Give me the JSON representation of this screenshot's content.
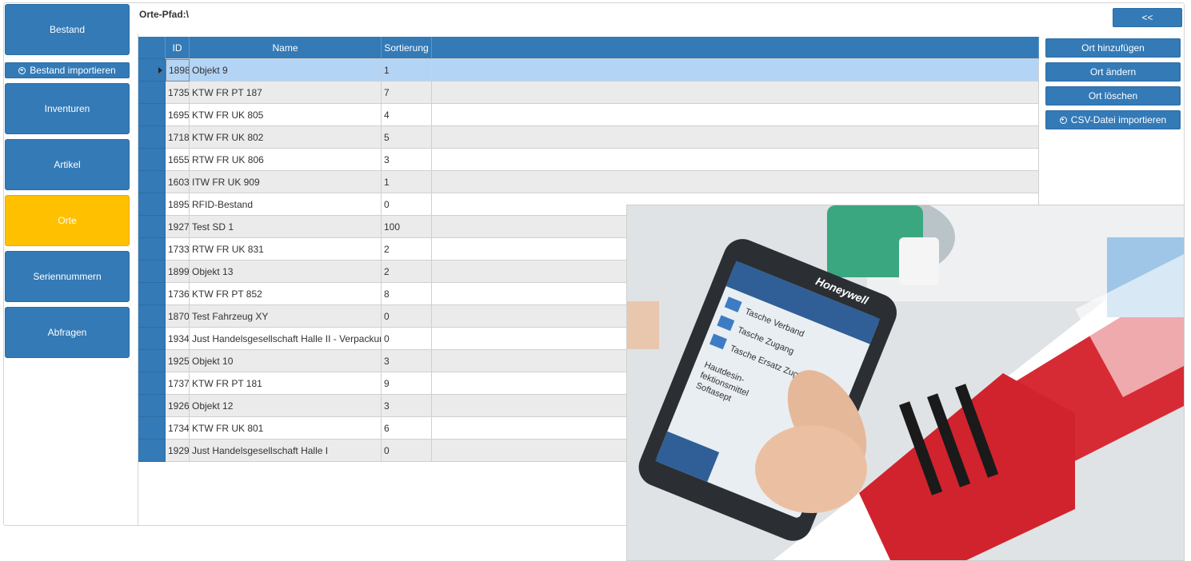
{
  "sidebar": {
    "bestand": "Bestand",
    "bestand_import": "Bestand importieren",
    "inventuren": "Inventuren",
    "artikel": "Artikel",
    "orte": "Orte",
    "seriennummern": "Seriennummern",
    "abfragen": "Abfragen"
  },
  "path_label": "Orte-Pfad:\\",
  "collapse_label": "<<",
  "table": {
    "headers": {
      "id": "ID",
      "name": "Name",
      "sort": "Sortierung"
    },
    "rows": [
      {
        "id": "1898",
        "name": "Objekt 9",
        "sort": "1"
      },
      {
        "id": "1735",
        "name": "KTW FR PT 187",
        "sort": "7"
      },
      {
        "id": "1695",
        "name": "KTW FR UK 805",
        "sort": "4"
      },
      {
        "id": "1718",
        "name": "KTW FR UK 802",
        "sort": "5"
      },
      {
        "id": "1655",
        "name": "RTW FR UK 806",
        "sort": "3"
      },
      {
        "id": "1603",
        "name": "ITW FR UK 909",
        "sort": "1"
      },
      {
        "id": "1895",
        "name": "RFID-Bestand",
        "sort": "0"
      },
      {
        "id": "1927",
        "name": "Test SD 1",
        "sort": "100"
      },
      {
        "id": "1733",
        "name": "RTW FR UK 831",
        "sort": "2"
      },
      {
        "id": "1899",
        "name": "Objekt 13",
        "sort": "2"
      },
      {
        "id": "1736",
        "name": "KTW FR PT 852",
        "sort": "8"
      },
      {
        "id": "1870",
        "name": "Test Fahrzeug XY",
        "sort": "0"
      },
      {
        "id": "1934",
        "name": "Just Handelsgesellschaft Halle II - Verpackung",
        "sort": "0"
      },
      {
        "id": "1925",
        "name": "Objekt 10",
        "sort": "3"
      },
      {
        "id": "1737",
        "name": "KTW FR PT 181",
        "sort": "9"
      },
      {
        "id": "1926",
        "name": "Objekt 12",
        "sort": "3"
      },
      {
        "id": "1734",
        "name": "KTW FR UK 801",
        "sort": "6"
      },
      {
        "id": "1929",
        "name": "Just Handelsgesellschaft Halle I",
        "sort": "0"
      }
    ]
  },
  "actions": {
    "add": "Ort hinzufügen",
    "edit": "Ort ändern",
    "delete": "Ort löschen",
    "csv_import": "CSV-Datei importieren"
  },
  "photo": {
    "brand": "Honeywell",
    "items": [
      "Tasche Verband",
      "Tasche Zugang",
      "Tasche Ersatz Zugang",
      "Hautdesin-",
      "fektionsmittel",
      "Softasept"
    ]
  },
  "colors": {
    "primary": "#337ab7",
    "active_nav": "#ffc000",
    "selected_row": "#b3d4f5"
  }
}
